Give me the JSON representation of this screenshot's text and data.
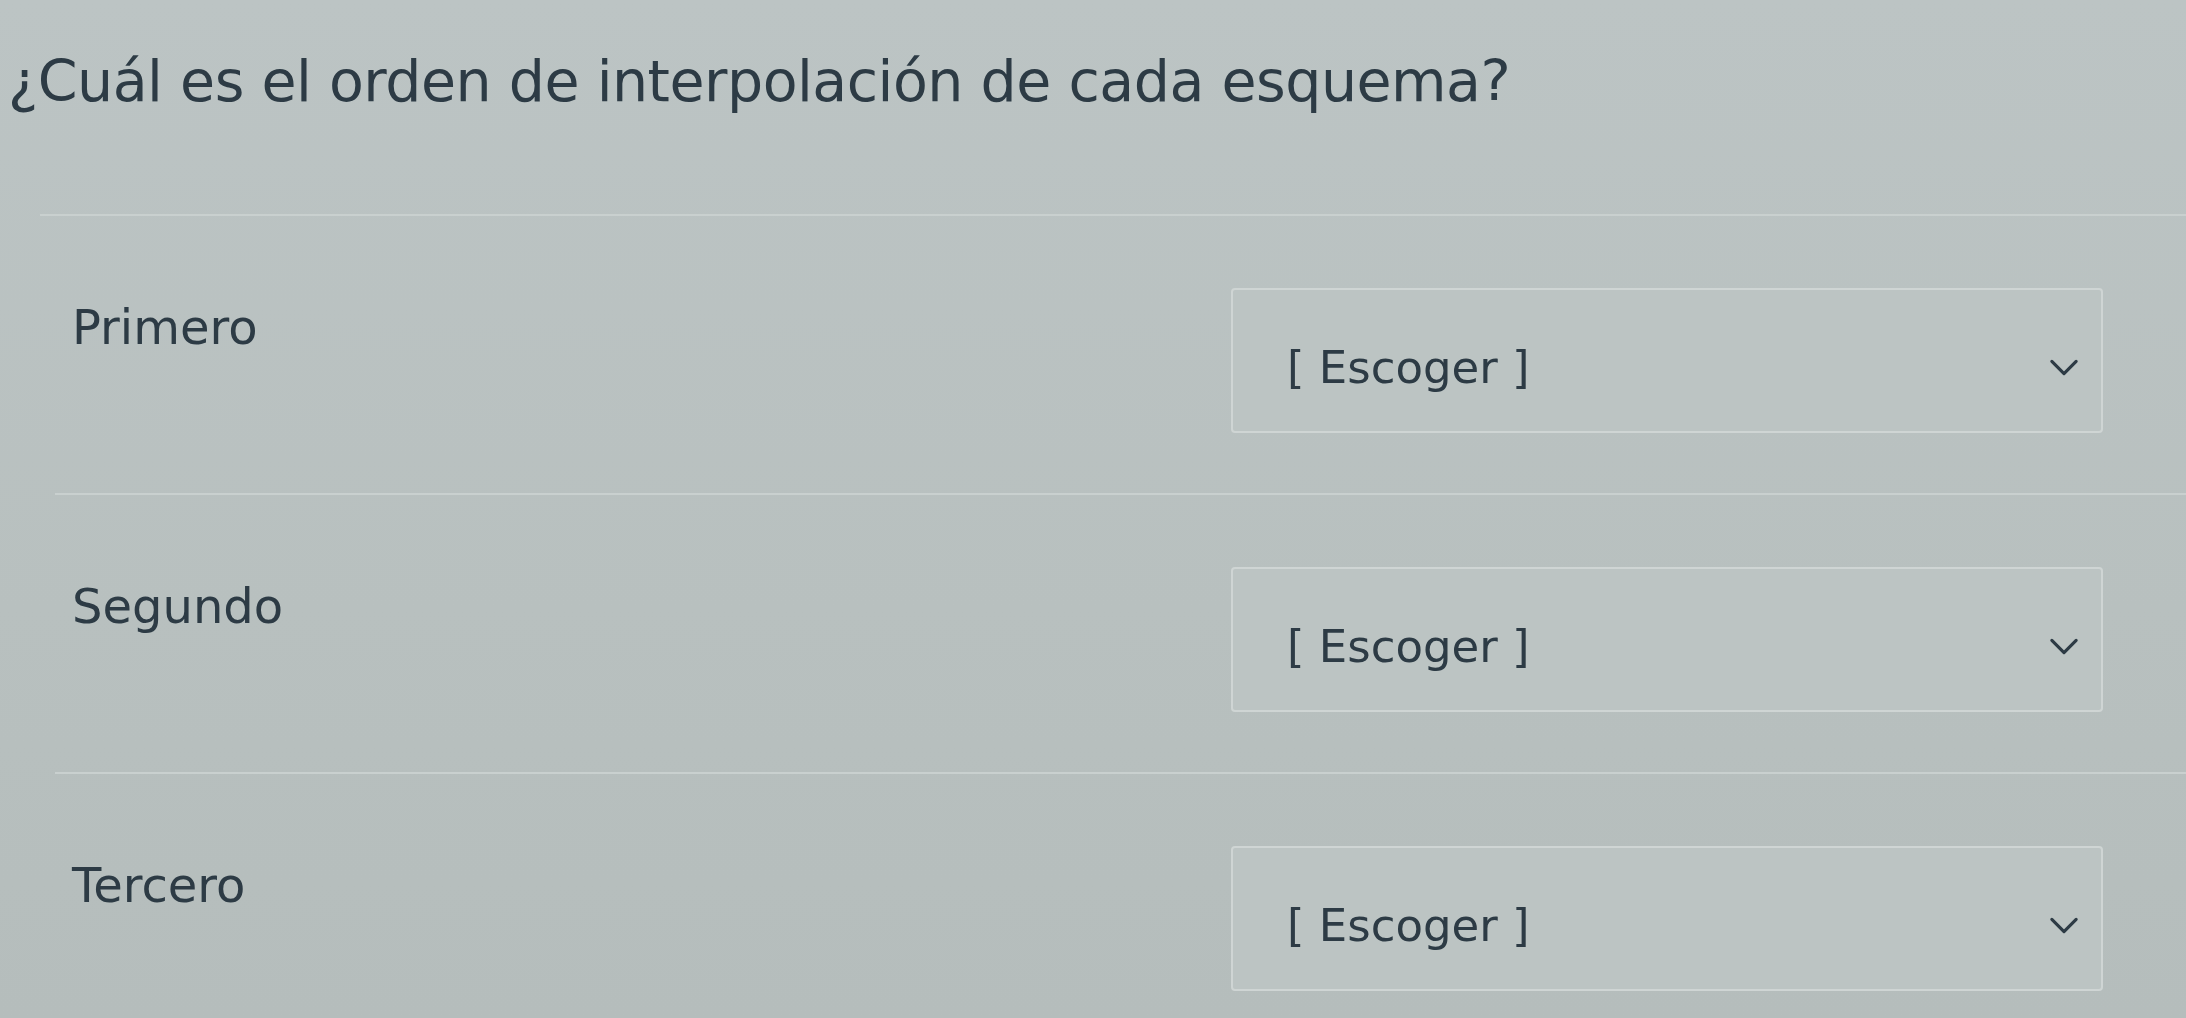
{
  "question": {
    "text": "¿Cuál es el orden de interpolación de cada esquema?"
  },
  "rows": [
    {
      "label": "Primero",
      "dropdown": {
        "value": "[ Escoger ]"
      }
    },
    {
      "label": "Segundo",
      "dropdown": {
        "value": "[ Escoger ]"
      }
    },
    {
      "label": "Tercero",
      "dropdown": {
        "value": "[ Escoger ]"
      }
    }
  ]
}
